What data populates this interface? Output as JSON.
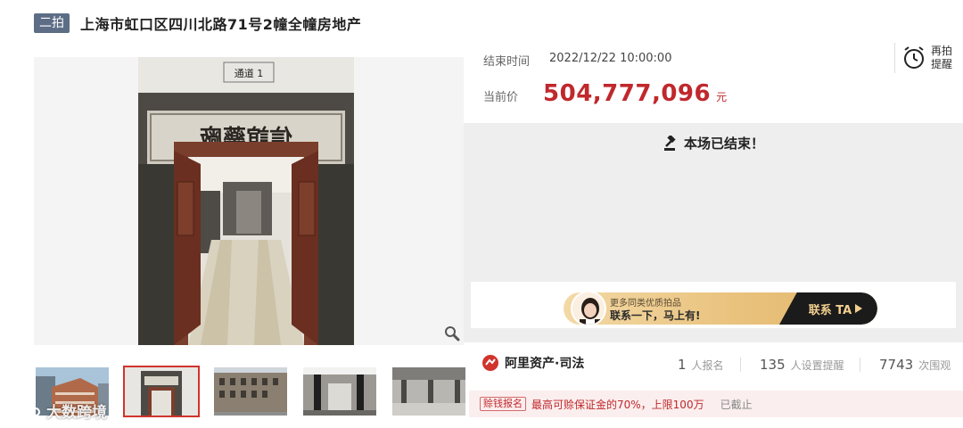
{
  "header": {
    "round_badge": "二拍",
    "title": "上海市虹口区四川北路71号2幢全幢房地产"
  },
  "auction": {
    "end_time_label": "结束时间",
    "end_time_value": "2022/12/22 10:00:00",
    "price_label": "当前价",
    "price_value": "504,777,096",
    "price_unit": "元",
    "remind_label": "再拍提醒",
    "status_text": "本场已结束！"
  },
  "promo": {
    "line1": "更多同类优质拍品",
    "line2": "联系一下，马上有!",
    "contact_label": "联系 TA"
  },
  "brand": {
    "name": "阿里资产·司法"
  },
  "stats": [
    {
      "num": "1",
      "label": "人报名"
    },
    {
      "num": "135",
      "label": "人设置提醒"
    },
    {
      "num": "7743",
      "label": "次围观"
    }
  ],
  "loan": {
    "tag": "赊钱报名",
    "text": "最高可赊保证金的70%，上限100万",
    "status": "已截止"
  },
  "photo": {
    "door_sign": "通道 1",
    "plaque_text": "信誼藥廠"
  },
  "watermark": {
    "text": "大数跨境"
  },
  "icons": {
    "zoom": "magnifier-icon",
    "remind": "alarm-clock-icon",
    "gavel": "gavel-icon",
    "brand": "ali-asset-logo-icon",
    "arrow": "triangle-right-icon"
  }
}
